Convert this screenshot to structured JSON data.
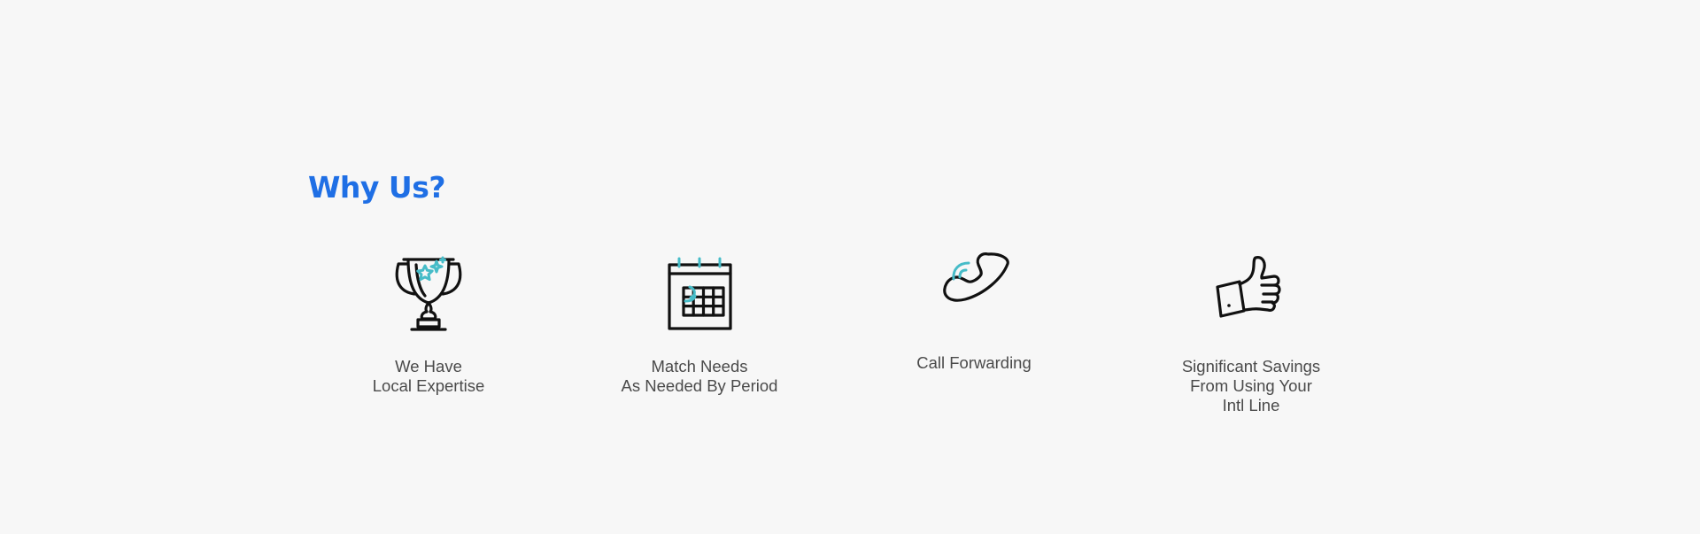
{
  "section": {
    "title": "Why Us?"
  },
  "colors": {
    "title": "#1f6fe5",
    "caption": "#4a4a4a",
    "icon_stroke": "#111111",
    "icon_accent": "#46bcc8",
    "background": "#f7f7f7"
  },
  "features": [
    {
      "icon": "trophy-icon",
      "caption": "We Have\nLocal Expertise"
    },
    {
      "icon": "calendar-icon",
      "caption": "Match Needs\nAs Needed By Period"
    },
    {
      "icon": "phone-icon",
      "caption": "Call Forwarding"
    },
    {
      "icon": "thumbs-up-icon",
      "caption": "Significant Savings\nFrom Using Your\nIntl Line"
    }
  ]
}
